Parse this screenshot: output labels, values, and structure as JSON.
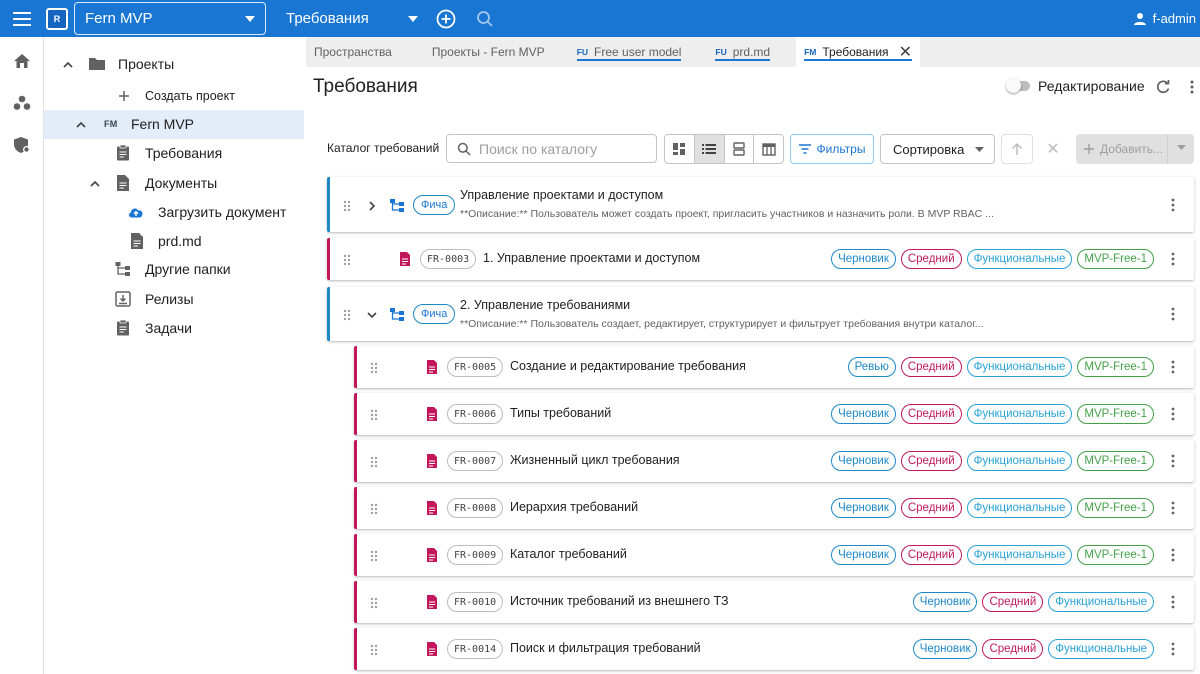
{
  "topbar": {
    "logo_text": "R",
    "project": "Fern MVP",
    "section": "Требования",
    "user": "f-admin"
  },
  "sidebar": {
    "items": [
      {
        "label": "Проекты"
      },
      {
        "label": "Создать проект"
      },
      {
        "badge": "FM",
        "label": "Fern MVP"
      },
      {
        "label": "Требования"
      },
      {
        "label": "Документы"
      },
      {
        "label": "Загрузить документ"
      },
      {
        "label": "prd.md"
      },
      {
        "label": "Другие папки"
      },
      {
        "label": "Релизы"
      },
      {
        "label": "Задачи"
      }
    ]
  },
  "tabs": [
    {
      "label": "Пространства"
    },
    {
      "label": "Проекты - Fern MVP"
    },
    {
      "badge": "FU",
      "label": "Free user model"
    },
    {
      "badge": "FU",
      "label": "prd.md"
    },
    {
      "badge": "FM",
      "label": "Требования"
    }
  ],
  "page": {
    "title": "Требования",
    "edit_label": "Редактирование"
  },
  "toolbar": {
    "catalog_label": "Каталог требований",
    "search_placeholder": "Поиск по каталогу",
    "filters_label": "Фильтры",
    "sort_label": "Сортировка",
    "add_label": "Добавить..."
  },
  "colors": {
    "primary": "#1976d2",
    "feature_accent": "#1e88c7",
    "requirement_accent": "#c2185b",
    "tag_draft": "#1e88c7",
    "tag_review": "#1e88c7",
    "tag_priority": "#c2185b",
    "tag_category": "#29a3d6",
    "tag_release": "#43a047"
  },
  "feature_label": "Фича",
  "rows": [
    {
      "kind": "feature",
      "title": "Управление проектами и доступом",
      "description": "**Описание:** Пользователь может создать проект, пригласить участников и назначить роли. В MVP RBAC ...",
      "expanded": false
    },
    {
      "kind": "requirement",
      "code": "FR-0003",
      "title": "1. Управление проектами и доступом",
      "tags": [
        "Черновик",
        "Средний",
        "Функциональные",
        "MVP-Free-1"
      ]
    },
    {
      "kind": "feature",
      "title": "2. Управление требованиями",
      "description": "**Описание:** Пользователь создает, редактирует, структурирует и фильтрует требования внутри каталог...",
      "expanded": true
    },
    {
      "kind": "requirement",
      "code": "FR-0005",
      "title": "Создание и редактирование требования",
      "tags": [
        "Ревью",
        "Средний",
        "Функциональные",
        "MVP-Free-1"
      ]
    },
    {
      "kind": "requirement",
      "code": "FR-0006",
      "title": "Типы требований",
      "tags": [
        "Черновик",
        "Средний",
        "Функциональные",
        "MVP-Free-1"
      ]
    },
    {
      "kind": "requirement",
      "code": "FR-0007",
      "title": "Жизненный цикл требования",
      "tags": [
        "Черновик",
        "Средний",
        "Функциональные",
        "MVP-Free-1"
      ]
    },
    {
      "kind": "requirement",
      "code": "FR-0008",
      "title": "Иерархия требований",
      "tags": [
        "Черновик",
        "Средний",
        "Функциональные",
        "MVP-Free-1"
      ]
    },
    {
      "kind": "requirement",
      "code": "FR-0009",
      "title": "Каталог требований",
      "tags": [
        "Черновик",
        "Средний",
        "Функциональные",
        "MVP-Free-1"
      ]
    },
    {
      "kind": "requirement",
      "code": "FR-0010",
      "title": "Источник требований из внешнего ТЗ",
      "tags": [
        "Черновик",
        "Средний",
        "Функциональные"
      ]
    },
    {
      "kind": "requirement",
      "code": "FR-0014",
      "title": "Поиск и фильтрация требований",
      "tags": [
        "Черновик",
        "Средний",
        "Функциональные"
      ]
    }
  ]
}
